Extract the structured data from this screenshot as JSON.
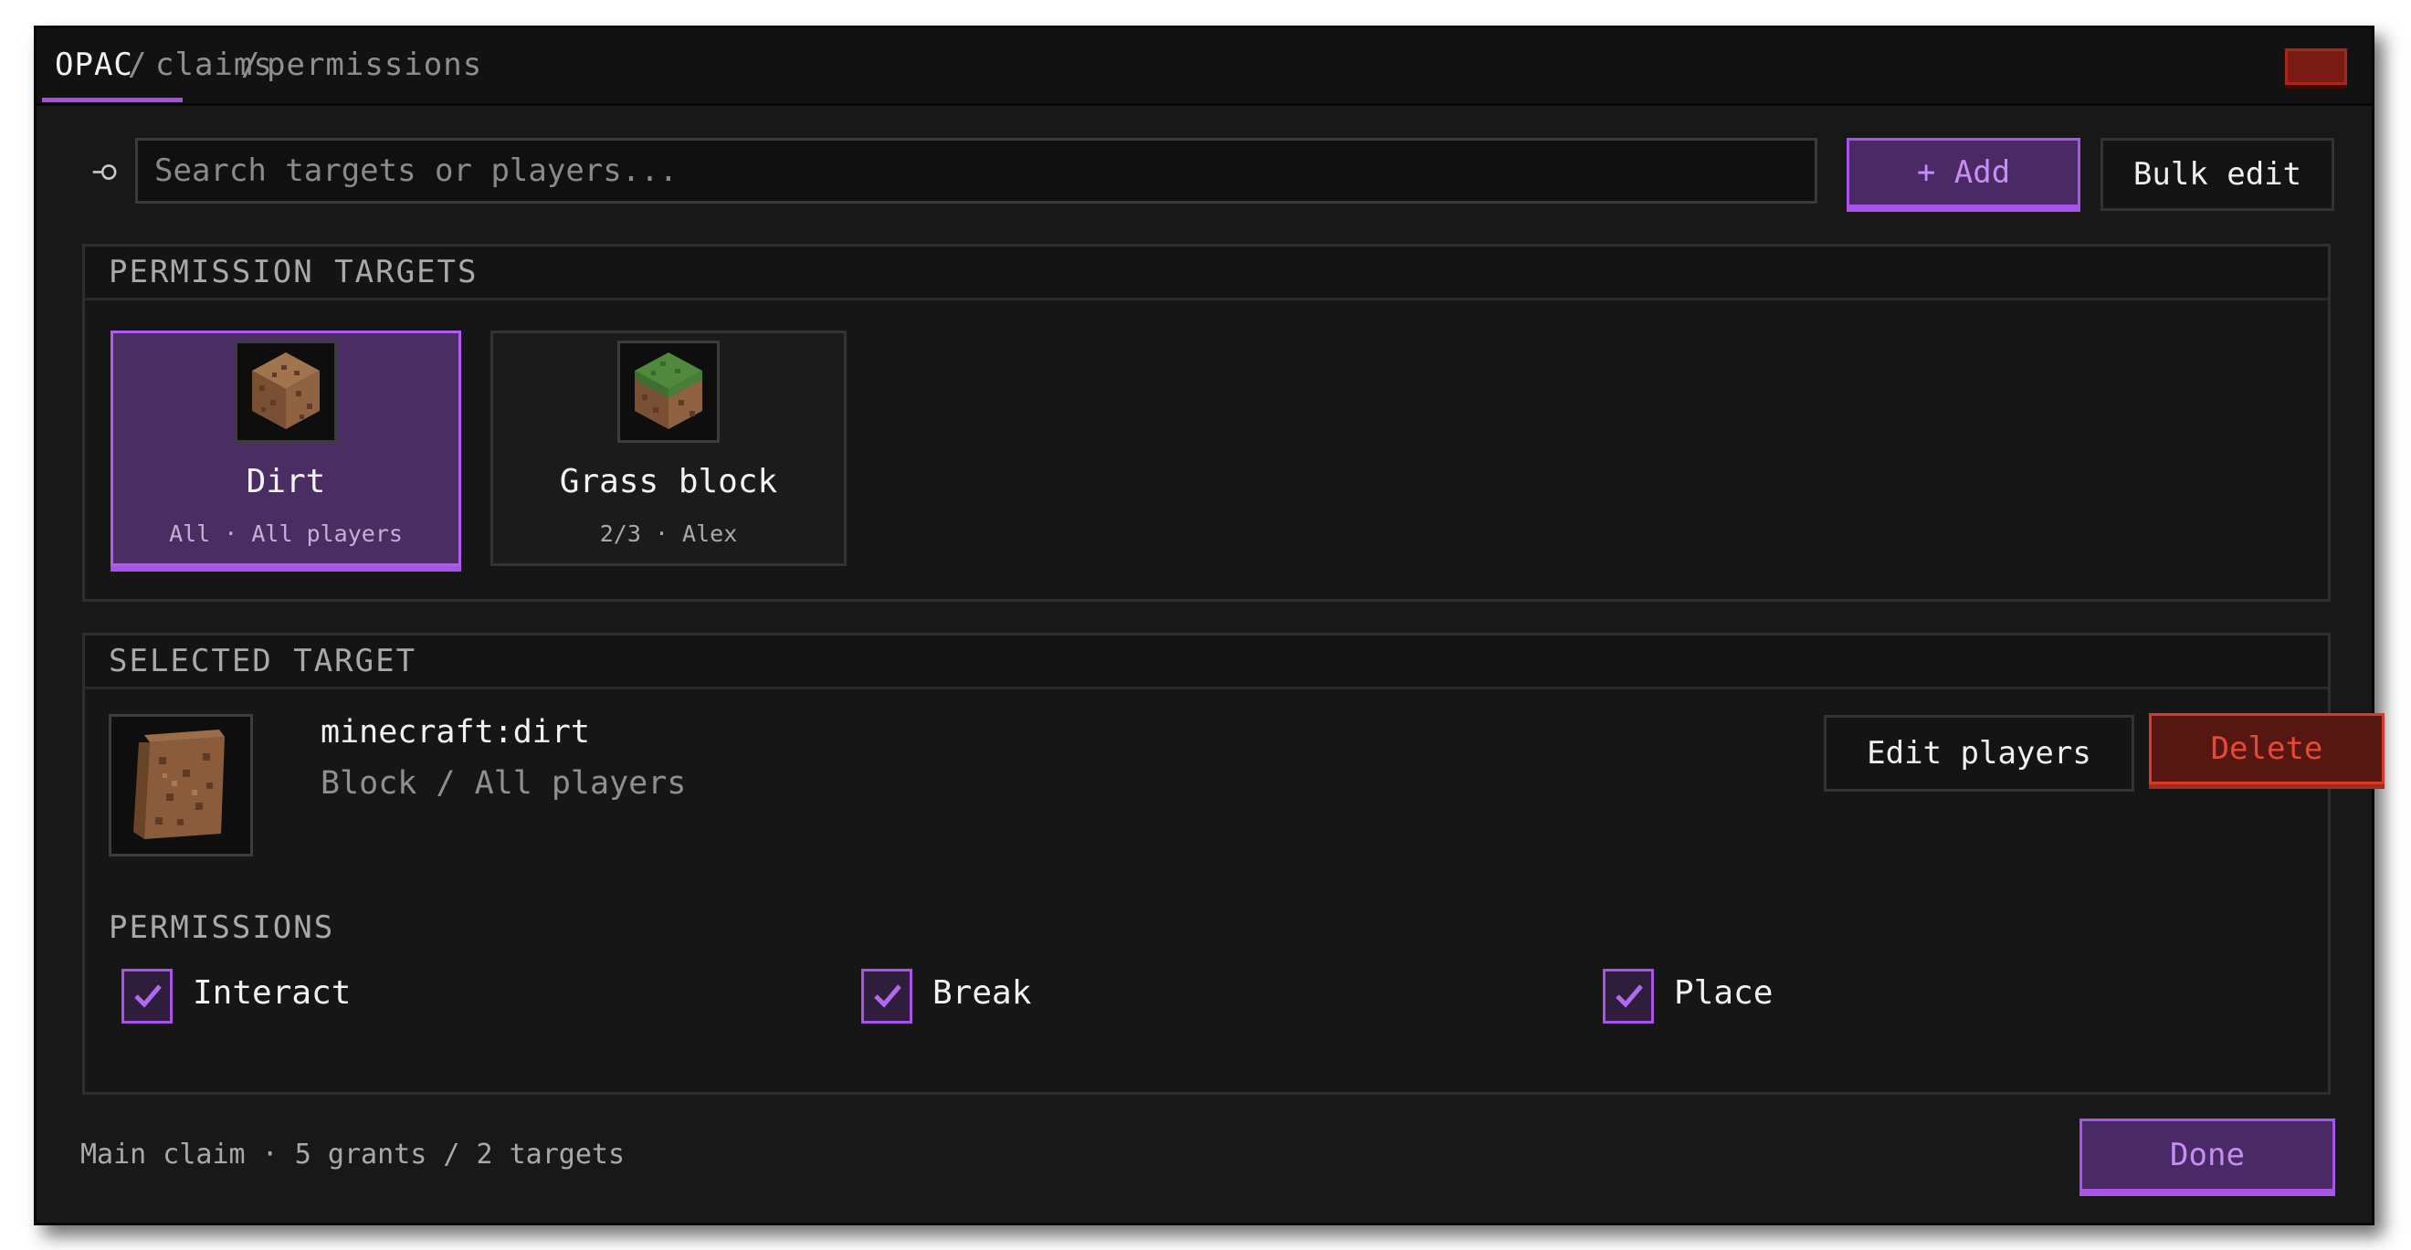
{
  "breadcrumb": [
    "OPAC",
    "claims",
    "permissions"
  ],
  "breadcrumb_separator": "/",
  "search": {
    "placeholder": "Search targets or players..."
  },
  "toolbar": {
    "add_label": "+ Add",
    "bulk_label": "Bulk edit"
  },
  "targets_panel": {
    "title": "PERMISSION TARGETS",
    "cards": [
      {
        "name": "Dirt",
        "sub": "All · All players",
        "icon": "dirt-block-icon",
        "selected": true
      },
      {
        "name": "Grass block",
        "sub": "2/3 · Alex",
        "icon": "grass-block-icon",
        "selected": false
      }
    ]
  },
  "selected_panel": {
    "title": "SELECTED TARGET",
    "id": "minecraft:dirt",
    "meta": "Block / All players",
    "edit_label": "Edit players",
    "delete_label": "Delete",
    "permissions_title": "PERMISSIONS",
    "permissions": [
      {
        "label": "Interact",
        "checked": true
      },
      {
        "label": "Break",
        "checked": true
      },
      {
        "label": "Place",
        "checked": true
      }
    ]
  },
  "footer": {
    "status": "Main claim · 5 grants / 2 targets",
    "done_label": "Done"
  },
  "colors": {
    "accent": "#a854e6",
    "danger": "#d8392a",
    "background": "#181818"
  }
}
